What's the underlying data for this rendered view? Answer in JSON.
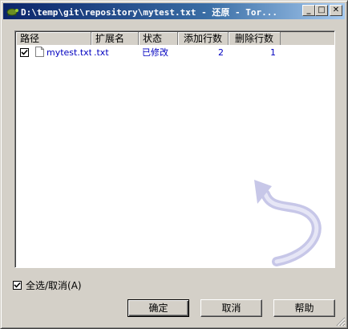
{
  "window": {
    "title": "D:\\temp\\git\\repository\\mytest.txt - 还原 - Tor...",
    "min_symbol": "_",
    "max_symbol": "□",
    "close_symbol": "✕"
  },
  "table": {
    "columns": [
      "路径",
      "扩展名",
      "状态",
      "添加行数",
      "删除行数"
    ],
    "rows": [
      {
        "checked": true,
        "path": "mytest.txt",
        "ext": ".txt",
        "status": "已修改",
        "added": "2",
        "deleted": "1"
      }
    ]
  },
  "select_all": {
    "label": "全选/取消(A)",
    "checked": true
  },
  "buttons": {
    "ok": "确定",
    "cancel": "取消",
    "help": "帮助"
  },
  "colors": {
    "row_text": "#0000c0",
    "titlebar_start": "#0a246a",
    "titlebar_end": "#a6caf0"
  }
}
